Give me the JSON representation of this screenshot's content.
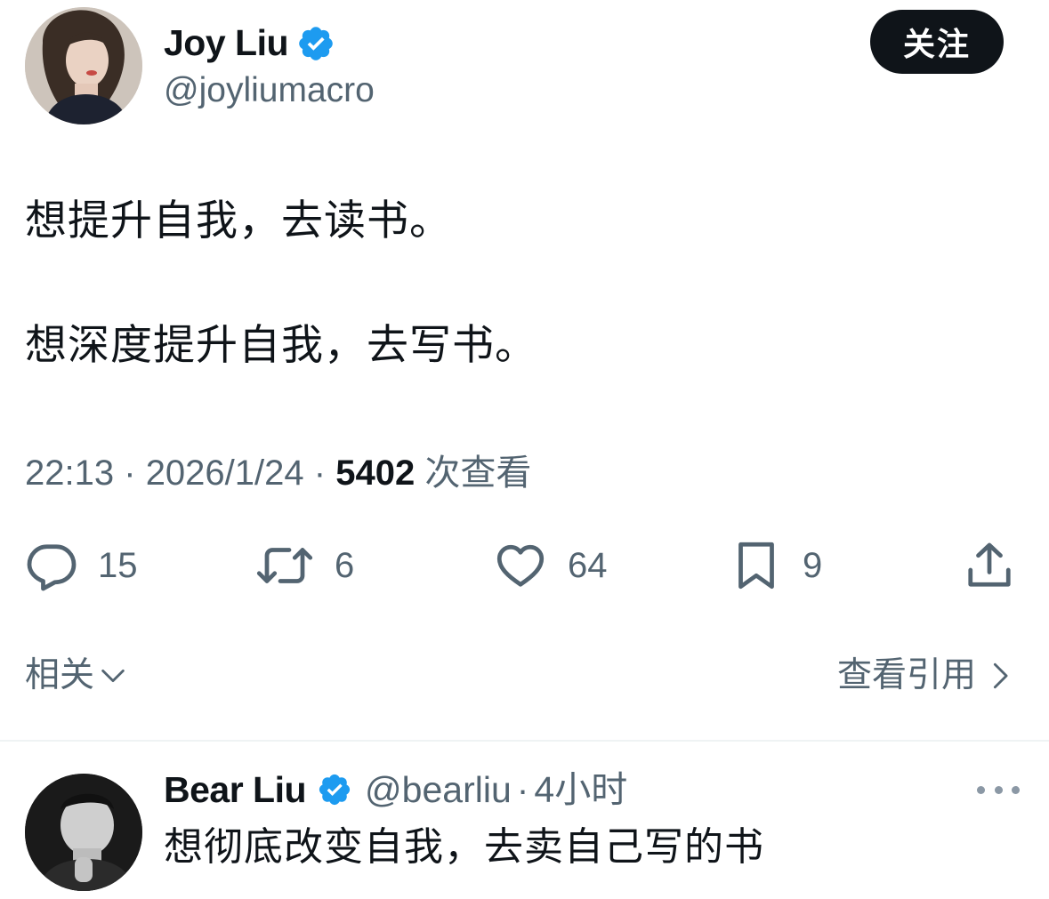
{
  "post": {
    "author": {
      "name": "Joy Liu",
      "handle": "@joyliumacro",
      "verified": true
    },
    "follow_label": "关注",
    "text_lines": [
      "想提升自我，去读书。",
      "想深度提升自我，去写书。"
    ],
    "meta": {
      "time": "22:13",
      "sep": "·",
      "date": "2026/1/24",
      "views": "5402",
      "views_label": "次查看"
    },
    "actions": {
      "replies": "15",
      "reposts": "6",
      "likes": "64",
      "bookmarks": "9"
    }
  },
  "related_label": "相关",
  "quotes_label": "查看引用",
  "reply": {
    "name": "Bear Liu",
    "handle": "@bearliu",
    "sep": "·",
    "time": "4小时",
    "text": "想彻底改变自我，去卖自己写的书"
  },
  "colors": {
    "text": "#0f1419",
    "secondary": "#536471",
    "verified_badge": "#1d9bf0",
    "button_bg": "#0f1419",
    "divider": "#eff3f4"
  },
  "icons": [
    "verified-badge-icon",
    "reply-icon",
    "repost-icon",
    "like-icon",
    "bookmark-icon",
    "share-icon",
    "chevron-down-icon",
    "chevron-right-icon",
    "more-icon"
  ]
}
